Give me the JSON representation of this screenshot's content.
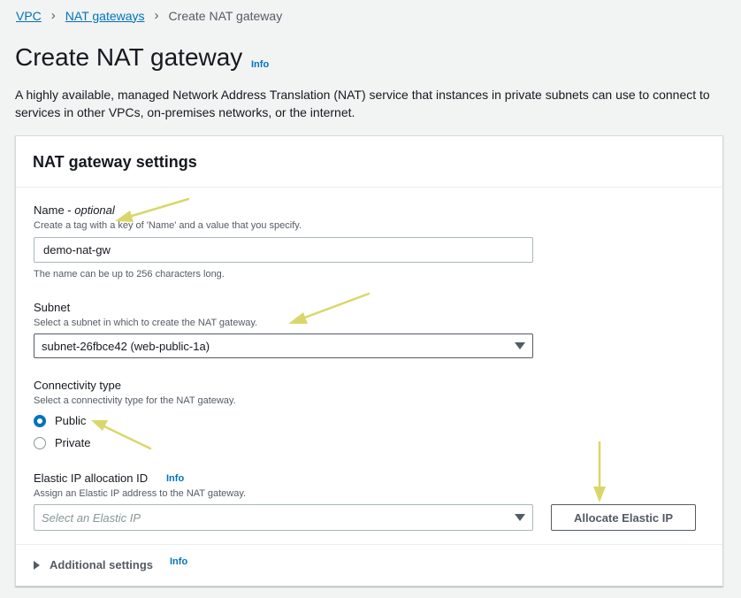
{
  "breadcrumb": {
    "items": [
      "VPC",
      "NAT gateways"
    ],
    "current": "Create NAT gateway"
  },
  "page": {
    "title": "Create NAT gateway",
    "info": "Info",
    "description": "A highly available, managed Network Address Translation (NAT) service that instances in private subnets can use to connect to services in other VPCs, on-premises networks, or the internet."
  },
  "settings": {
    "title": "NAT gateway settings",
    "name": {
      "label": "Name - ",
      "label_optional": "optional",
      "description": "Create a tag with a key of 'Name' and a value that you specify.",
      "value": "demo-nat-gw",
      "constraint": "The name can be up to 256 characters long."
    },
    "subnet": {
      "label": "Subnet",
      "description": "Select a subnet in which to create the NAT gateway.",
      "value": "subnet-26fbce42 (web-public-1a)"
    },
    "connectivity": {
      "label": "Connectivity type",
      "description": "Select a connectivity type for the NAT gateway.",
      "options": [
        "Public",
        "Private"
      ],
      "selected": "Public"
    },
    "elastic_ip": {
      "label": "Elastic IP allocation ID",
      "info": "Info",
      "description": "Assign an Elastic IP address to the NAT gateway.",
      "placeholder": "Select an Elastic IP",
      "allocate_button": "Allocate Elastic IP"
    },
    "additional": {
      "label": "Additional settings",
      "info": "Info"
    }
  },
  "colors": {
    "link": "#0073bb",
    "annotation_arrow": "#d9d76b"
  }
}
